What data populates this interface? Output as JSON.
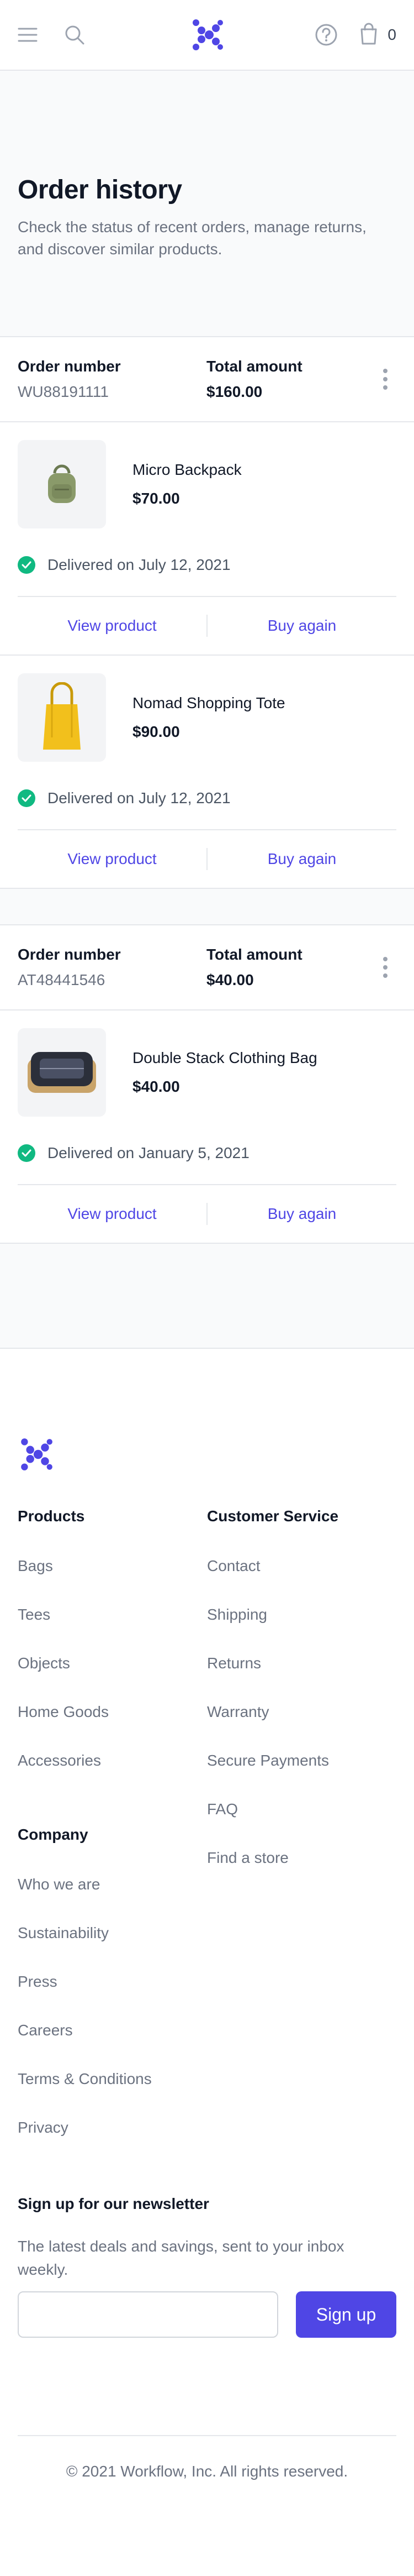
{
  "header": {
    "menu_icon": "menu-icon",
    "search_icon": "search-icon",
    "logo_icon": "workflow-logo-icon",
    "help_icon": "help-circle-icon",
    "cart_icon": "shopping-bag-icon",
    "cart_count": "0"
  },
  "page": {
    "title": "Order history",
    "subtitle": "Check the status of recent orders, manage returns, and discover similar products."
  },
  "orders": [
    {
      "number_label": "Order number",
      "number": "WU88191111",
      "total_label": "Total amount",
      "total": "$160.00",
      "items": [
        {
          "name": "Micro Backpack",
          "price": "$70.00",
          "status": "Delivered on July 12, 2021",
          "view": "View product",
          "buy": "Buy again"
        },
        {
          "name": "Nomad Shopping Tote",
          "price": "$90.00",
          "status": "Delivered on July 12, 2021",
          "view": "View product",
          "buy": "Buy again"
        }
      ]
    },
    {
      "number_label": "Order number",
      "number": "AT48441546",
      "total_label": "Total amount",
      "total": "$40.00",
      "items": [
        {
          "name": "Double Stack Clothing Bag",
          "price": "$40.00",
          "status": "Delivered on January 5, 2021",
          "view": "View product",
          "buy": "Buy again"
        }
      ]
    }
  ],
  "footer": {
    "products_heading": "Products",
    "products": [
      "Bags",
      "Tees",
      "Objects",
      "Home Goods",
      "Accessories"
    ],
    "company_heading": "Company",
    "company": [
      "Who we are",
      "Sustainability",
      "Press",
      "Careers",
      "Terms & Conditions",
      "Privacy"
    ],
    "service_heading": "Customer Service",
    "service": [
      "Contact",
      "Shipping",
      "Returns",
      "Warranty",
      "Secure Payments",
      "FAQ",
      "Find a store"
    ],
    "newsletter_heading": "Sign up for our newsletter",
    "newsletter_text": "The latest deals and savings, sent to your inbox weekly.",
    "newsletter_placeholder": "",
    "signup_label": "Sign up",
    "copyright": "© 2021 Workflow, Inc. All rights reserved."
  },
  "colors": {
    "accent": "#4f46e5",
    "success": "#10b981"
  }
}
